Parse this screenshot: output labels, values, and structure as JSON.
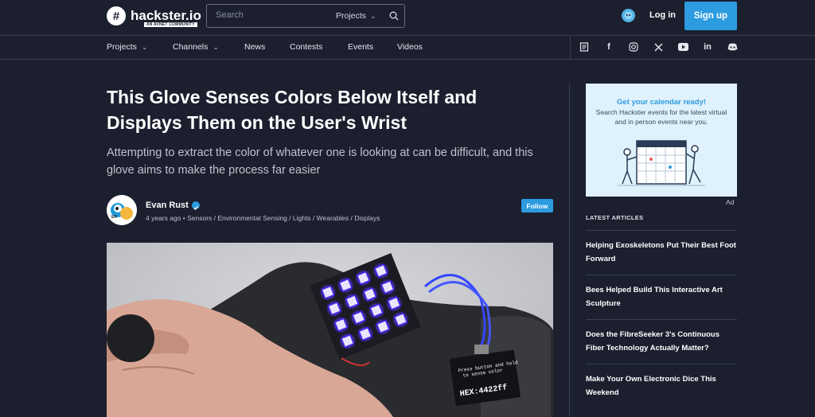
{
  "header": {
    "logo_text": "hackster.io",
    "logo_sub": "AN AVNET COMMUNITY",
    "search_placeholder": "Search",
    "search_scope": "Projects",
    "login": "Log in",
    "signup": "Sign up"
  },
  "nav": {
    "items": [
      {
        "label": "Projects",
        "has_dropdown": true
      },
      {
        "label": "Channels",
        "has_dropdown": true
      },
      {
        "label": "News",
        "has_dropdown": false
      },
      {
        "label": "Contests",
        "has_dropdown": false
      },
      {
        "label": "Events",
        "has_dropdown": false
      },
      {
        "label": "Videos",
        "has_dropdown": false
      }
    ],
    "social_icons": [
      "newsletter-icon",
      "facebook-icon",
      "instagram-icon",
      "x-icon",
      "youtube-icon",
      "linkedin-icon",
      "discord-icon"
    ]
  },
  "article": {
    "title": "This Glove Senses Colors Below Itself and Displays Them on the User's Wrist",
    "subtitle": "Attempting to extract the color of whatever one is looking at can be difficult, and this glove aims to make the process far easier",
    "author": "Evan Rust",
    "meta": "4 years ago • Sensors / Environmental Sensing / Lights / Wearables / Displays",
    "follow": "Follow"
  },
  "sidebar": {
    "ad_title": "Get your calendar ready!",
    "ad_body": "Search Hackster events for the latest virtual and in person events near you.",
    "ad_label": "Ad",
    "latest_heading": "LATEST ARTICLES",
    "articles": [
      "Helping Exoskeletons Put Their Best Foot Forward",
      "Bees Helped Build This Interactive Art Sculpture",
      "Does the FibreSeeker 3's Continuous Fiber Technology Actually Matter?",
      "Make Your Own Electronic Dice This Weekend"
    ]
  },
  "hero_image": {
    "oled_line1": "Press button and hold",
    "oled_line2": "to sense color",
    "oled_hex": "HEX:4422ff"
  },
  "colors": {
    "background": "#1b1f2e",
    "accent": "#2c9be0",
    "led": "#4422ff"
  }
}
